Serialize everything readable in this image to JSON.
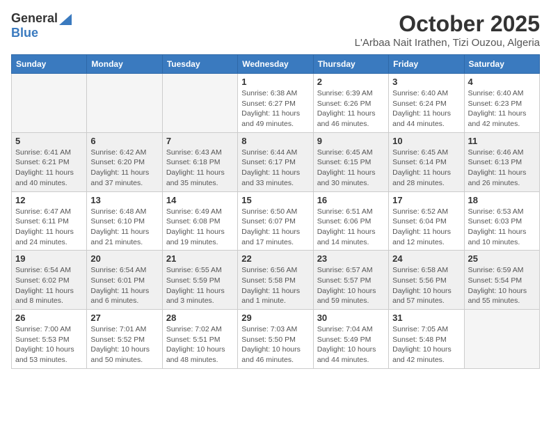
{
  "logo": {
    "general": "General",
    "blue": "Blue"
  },
  "title": "October 2025",
  "location": "L'Arbaa Nait Irathen, Tizi Ouzou, Algeria",
  "days_of_week": [
    "Sunday",
    "Monday",
    "Tuesday",
    "Wednesday",
    "Thursday",
    "Friday",
    "Saturday"
  ],
  "weeks": [
    [
      {
        "day": "",
        "info": ""
      },
      {
        "day": "",
        "info": ""
      },
      {
        "day": "",
        "info": ""
      },
      {
        "day": "1",
        "info": "Sunrise: 6:38 AM\nSunset: 6:27 PM\nDaylight: 11 hours and 49 minutes."
      },
      {
        "day": "2",
        "info": "Sunrise: 6:39 AM\nSunset: 6:26 PM\nDaylight: 11 hours and 46 minutes."
      },
      {
        "day": "3",
        "info": "Sunrise: 6:40 AM\nSunset: 6:24 PM\nDaylight: 11 hours and 44 minutes."
      },
      {
        "day": "4",
        "info": "Sunrise: 6:40 AM\nSunset: 6:23 PM\nDaylight: 11 hours and 42 minutes."
      }
    ],
    [
      {
        "day": "5",
        "info": "Sunrise: 6:41 AM\nSunset: 6:21 PM\nDaylight: 11 hours and 40 minutes."
      },
      {
        "day": "6",
        "info": "Sunrise: 6:42 AM\nSunset: 6:20 PM\nDaylight: 11 hours and 37 minutes."
      },
      {
        "day": "7",
        "info": "Sunrise: 6:43 AM\nSunset: 6:18 PM\nDaylight: 11 hours and 35 minutes."
      },
      {
        "day": "8",
        "info": "Sunrise: 6:44 AM\nSunset: 6:17 PM\nDaylight: 11 hours and 33 minutes."
      },
      {
        "day": "9",
        "info": "Sunrise: 6:45 AM\nSunset: 6:15 PM\nDaylight: 11 hours and 30 minutes."
      },
      {
        "day": "10",
        "info": "Sunrise: 6:45 AM\nSunset: 6:14 PM\nDaylight: 11 hours and 28 minutes."
      },
      {
        "day": "11",
        "info": "Sunrise: 6:46 AM\nSunset: 6:13 PM\nDaylight: 11 hours and 26 minutes."
      }
    ],
    [
      {
        "day": "12",
        "info": "Sunrise: 6:47 AM\nSunset: 6:11 PM\nDaylight: 11 hours and 24 minutes."
      },
      {
        "day": "13",
        "info": "Sunrise: 6:48 AM\nSunset: 6:10 PM\nDaylight: 11 hours and 21 minutes."
      },
      {
        "day": "14",
        "info": "Sunrise: 6:49 AM\nSunset: 6:08 PM\nDaylight: 11 hours and 19 minutes."
      },
      {
        "day": "15",
        "info": "Sunrise: 6:50 AM\nSunset: 6:07 PM\nDaylight: 11 hours and 17 minutes."
      },
      {
        "day": "16",
        "info": "Sunrise: 6:51 AM\nSunset: 6:06 PM\nDaylight: 11 hours and 14 minutes."
      },
      {
        "day": "17",
        "info": "Sunrise: 6:52 AM\nSunset: 6:04 PM\nDaylight: 11 hours and 12 minutes."
      },
      {
        "day": "18",
        "info": "Sunrise: 6:53 AM\nSunset: 6:03 PM\nDaylight: 11 hours and 10 minutes."
      }
    ],
    [
      {
        "day": "19",
        "info": "Sunrise: 6:54 AM\nSunset: 6:02 PM\nDaylight: 11 hours and 8 minutes."
      },
      {
        "day": "20",
        "info": "Sunrise: 6:54 AM\nSunset: 6:01 PM\nDaylight: 11 hours and 6 minutes."
      },
      {
        "day": "21",
        "info": "Sunrise: 6:55 AM\nSunset: 5:59 PM\nDaylight: 11 hours and 3 minutes."
      },
      {
        "day": "22",
        "info": "Sunrise: 6:56 AM\nSunset: 5:58 PM\nDaylight: 11 hours and 1 minute."
      },
      {
        "day": "23",
        "info": "Sunrise: 6:57 AM\nSunset: 5:57 PM\nDaylight: 10 hours and 59 minutes."
      },
      {
        "day": "24",
        "info": "Sunrise: 6:58 AM\nSunset: 5:56 PM\nDaylight: 10 hours and 57 minutes."
      },
      {
        "day": "25",
        "info": "Sunrise: 6:59 AM\nSunset: 5:54 PM\nDaylight: 10 hours and 55 minutes."
      }
    ],
    [
      {
        "day": "26",
        "info": "Sunrise: 7:00 AM\nSunset: 5:53 PM\nDaylight: 10 hours and 53 minutes."
      },
      {
        "day": "27",
        "info": "Sunrise: 7:01 AM\nSunset: 5:52 PM\nDaylight: 10 hours and 50 minutes."
      },
      {
        "day": "28",
        "info": "Sunrise: 7:02 AM\nSunset: 5:51 PM\nDaylight: 10 hours and 48 minutes."
      },
      {
        "day": "29",
        "info": "Sunrise: 7:03 AM\nSunset: 5:50 PM\nDaylight: 10 hours and 46 minutes."
      },
      {
        "day": "30",
        "info": "Sunrise: 7:04 AM\nSunset: 5:49 PM\nDaylight: 10 hours and 44 minutes."
      },
      {
        "day": "31",
        "info": "Sunrise: 7:05 AM\nSunset: 5:48 PM\nDaylight: 10 hours and 42 minutes."
      },
      {
        "day": "",
        "info": ""
      }
    ]
  ]
}
